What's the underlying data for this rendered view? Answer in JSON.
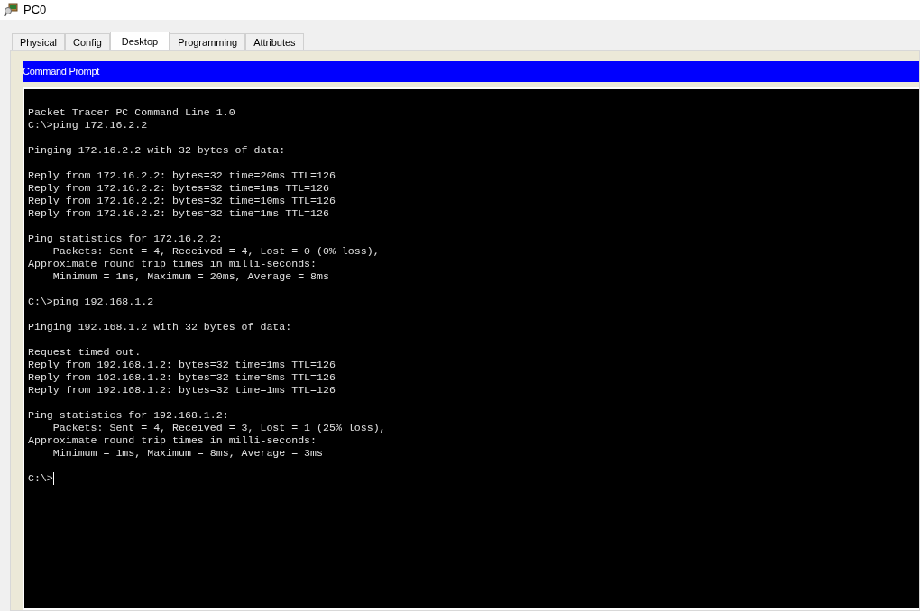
{
  "window": {
    "title": "PC0"
  },
  "tabs": [
    {
      "label": "Physical",
      "selected": false
    },
    {
      "label": "Config",
      "selected": false
    },
    {
      "label": "Desktop",
      "selected": true
    },
    {
      "label": "Programming",
      "selected": false
    },
    {
      "label": "Attributes",
      "selected": false
    }
  ],
  "app": {
    "title": "Command Prompt"
  },
  "terminal": {
    "blocks": [
      [
        "Packet Tracer PC Command Line 1.0",
        "C:\\>ping 172.16.2.2"
      ],
      [
        "Pinging 172.16.2.2 with 32 bytes of data:"
      ],
      [
        "Reply from 172.16.2.2: bytes=32 time=20ms TTL=126",
        "Reply from 172.16.2.2: bytes=32 time=1ms TTL=126",
        "Reply from 172.16.2.2: bytes=32 time=10ms TTL=126",
        "Reply from 172.16.2.2: bytes=32 time=1ms TTL=126"
      ],
      [
        "Ping statistics for 172.16.2.2:",
        "    Packets: Sent = 4, Received = 4, Lost = 0 (0% loss),",
        "Approximate round trip times in milli-seconds:",
        "    Minimum = 1ms, Maximum = 20ms, Average = 8ms"
      ],
      [
        "C:\\>ping 192.168.1.2"
      ],
      [
        "Pinging 192.168.1.2 with 32 bytes of data:"
      ],
      [
        "Request timed out.",
        "Reply from 192.168.1.2: bytes=32 time=1ms TTL=126",
        "Reply from 192.168.1.2: bytes=32 time=8ms TTL=126",
        "Reply from 192.168.1.2: bytes=32 time=1ms TTL=126"
      ],
      [
        "Ping statistics for 192.168.1.2:",
        "    Packets: Sent = 4, Received = 3, Lost = 1 (25% loss),",
        "Approximate round trip times in milli-seconds:",
        "    Minimum = 1ms, Maximum = 8ms, Average = 3ms"
      ]
    ],
    "prompt": "C:\\>"
  }
}
